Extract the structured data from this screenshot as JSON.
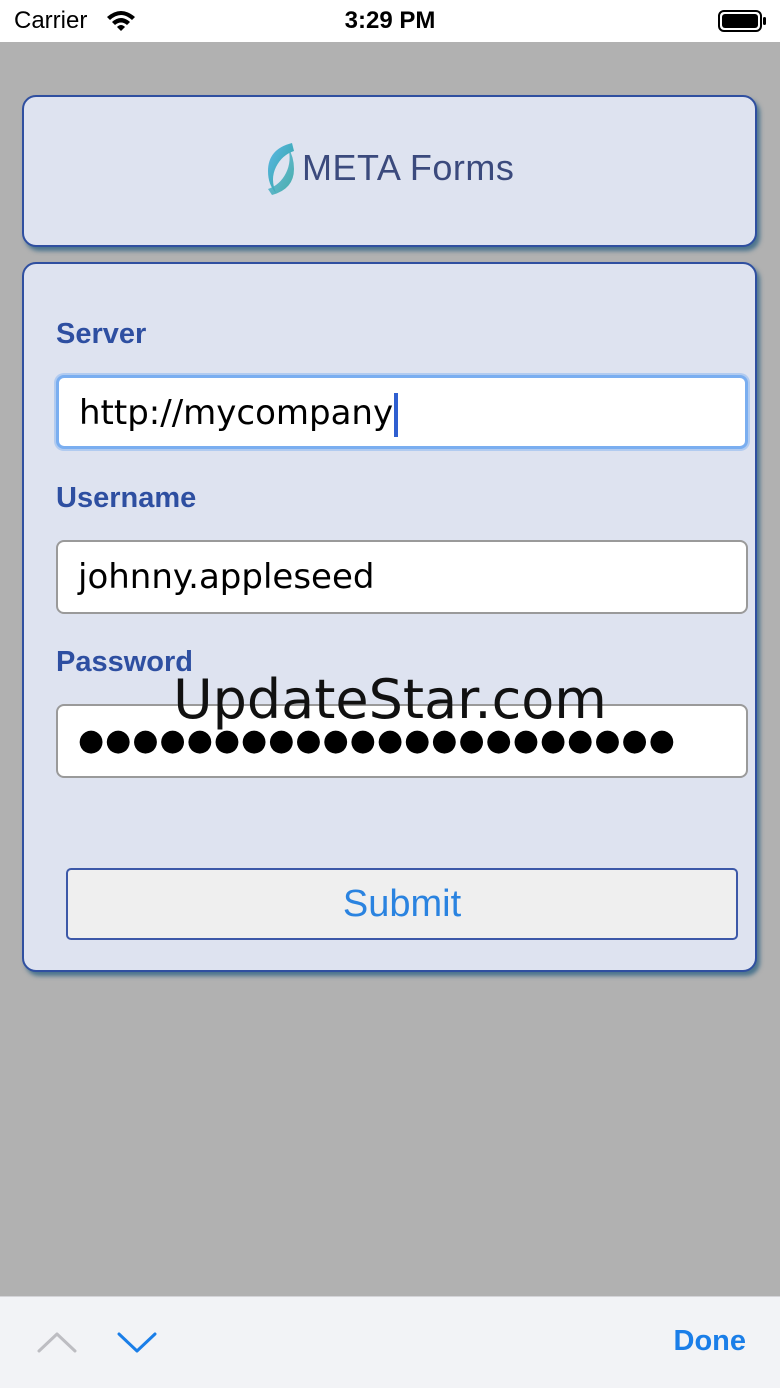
{
  "status_bar": {
    "carrier": "Carrier",
    "time": "3:29 PM"
  },
  "logo": {
    "text": "META Forms"
  },
  "form": {
    "server": {
      "label": "Server",
      "value": "http://mycompany"
    },
    "username": {
      "label": "Username",
      "value": "johnny.appleseed"
    },
    "password": {
      "label": "Password",
      "masked": "●●●●●●●●●●●●●●●●●●●●●●"
    },
    "submit_label": "Submit"
  },
  "watermark": "UpdateStar.com",
  "keyboard_toolbar": {
    "done_label": "Done"
  },
  "colors": {
    "background": "#b1b1b1",
    "card": "#dee3f0",
    "card_border": "#2f4fa0",
    "label": "#2e4fa1",
    "accent": "#1a7ee8",
    "focus_ring": "#7aaef0"
  },
  "icons": [
    "wifi-icon",
    "battery-icon",
    "meta-logo-icon",
    "chevron-up-icon",
    "chevron-down-icon"
  ]
}
